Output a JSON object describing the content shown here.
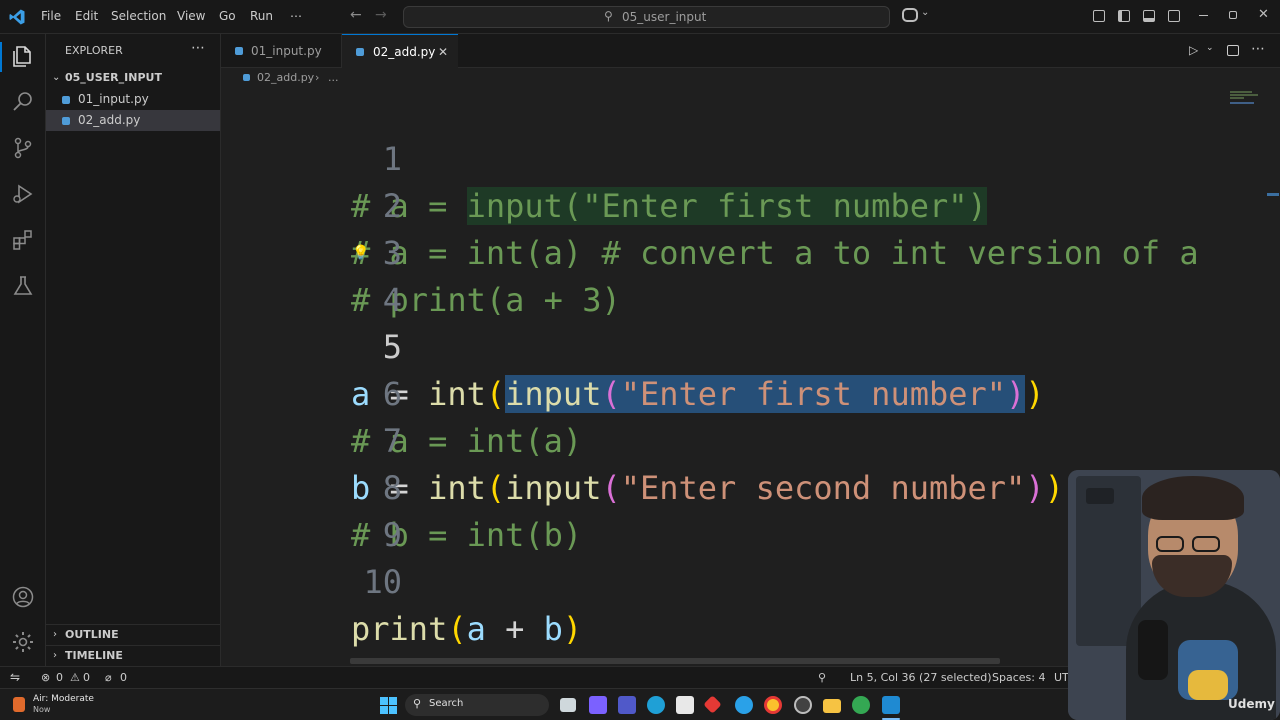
{
  "titlebar": {
    "menu": [
      "File",
      "Edit",
      "Selection",
      "View",
      "Go",
      "Run",
      "⋯"
    ],
    "search_text": "05_user_input"
  },
  "sidebar": {
    "title": "EXPLORER",
    "more": "⋯",
    "folder": "05_USER_INPUT",
    "files": [
      "01_input.py",
      "02_add.py"
    ],
    "outline": "OUTLINE",
    "timeline": "TIMELINE"
  },
  "tabs": [
    {
      "label": "01_input.py"
    },
    {
      "label": "02_add.py"
    }
  ],
  "breadcrumb": {
    "file": "02_add.py",
    "more": "..."
  },
  "editor": {
    "line_numbers": [
      "1",
      "2",
      "3",
      "4",
      "5",
      "6",
      "7",
      "8",
      "9",
      "10"
    ],
    "lines": {
      "l1": {
        "hash": "# a = ",
        "fn": "input",
        "rest": "(\"Enter first number\")"
      },
      "l2": "# a = int(a) # convert a to int version of a",
      "l3": "# print(a + 3)",
      "l5": {
        "a": "a",
        "eq": " = ",
        "int": "int",
        "p1": "(",
        "input": "input",
        "p2": "(",
        "str": "\"Enter first number\"",
        "p2c": ")",
        "p1c": ")"
      },
      "l6": "# a = int(a)",
      "l7": {
        "b": "b",
        "eq": " = ",
        "int": "int",
        "p1": "(",
        "input": "input",
        "p2": "(",
        "str": "\"Enter second number\"",
        "p2c": ")",
        "p1c": ")"
      },
      "l8": "# b = int(b)",
      "l10": {
        "print": "print",
        "p1": "(",
        "a": "a",
        "plus": " + ",
        "b": "b",
        "p1c": ")"
      }
    }
  },
  "statusbar": {
    "errors": "0",
    "warnings": "0",
    "ports": "0",
    "cursor": "Ln 5, Col 36 (27 selected)",
    "spaces": "Spaces: 4",
    "encoding": "UT"
  },
  "taskbar": {
    "weather_title": "Air: Moderate",
    "weather_sub": "Now",
    "search": "Search"
  },
  "webcam": {
    "watermark": "Udemy"
  }
}
